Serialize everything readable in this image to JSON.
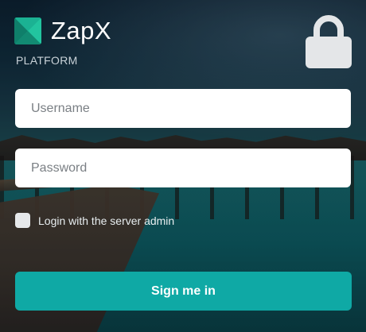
{
  "brand": {
    "name": "ZapX",
    "subtitle": "PLATFORM",
    "logo_icon": "zapx-logo-icon",
    "accent_color": "#0fa9a5"
  },
  "header": {
    "lock_icon": "lock-icon"
  },
  "form": {
    "username_placeholder": "Username",
    "username_value": "",
    "password_placeholder": "Password",
    "password_value": "",
    "server_admin_label": "Login with the server admin",
    "server_admin_checked": false,
    "submit_label": "Sign me in"
  }
}
